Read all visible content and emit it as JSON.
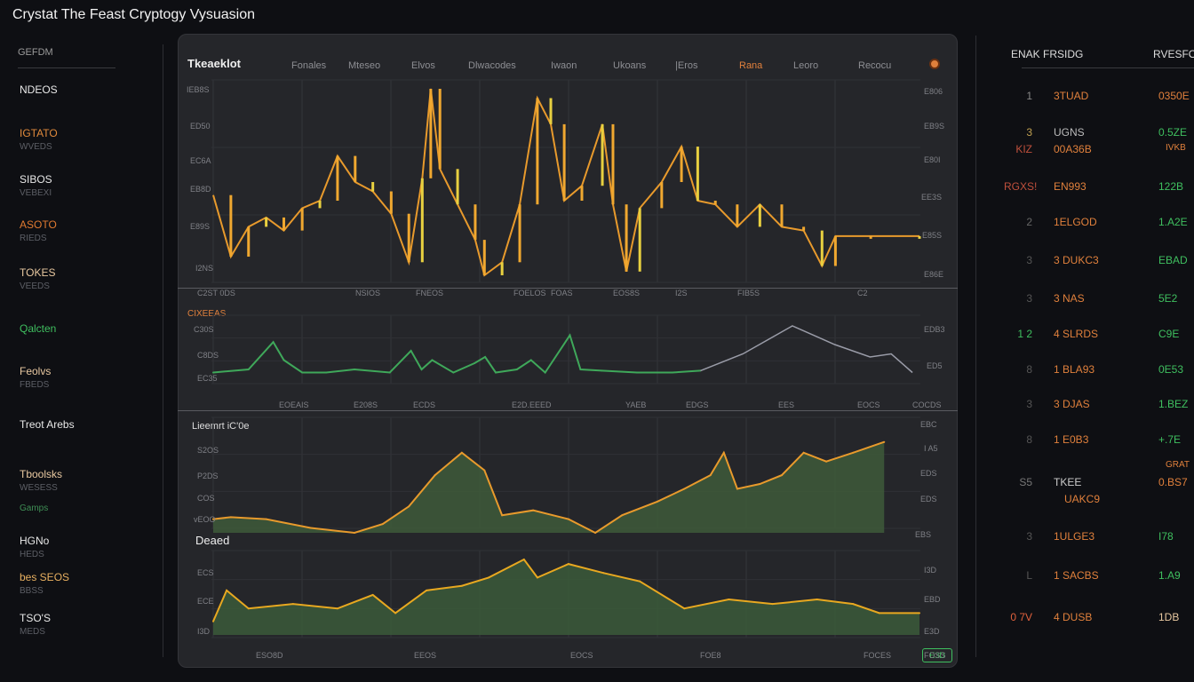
{
  "title": "Crystat The Feast Cryptogy Vysuasion",
  "sidebar": {
    "heading": "GEFDM",
    "items": [
      {
        "label": "NDEOS",
        "sub": "",
        "color": "#e8e8e8"
      },
      {
        "label": "IGTATO",
        "sub": "WVEDS",
        "color": "#e08a3c"
      },
      {
        "label": "SIBOS",
        "sub": "VEBEXI",
        "color": "#e8e8e8"
      },
      {
        "label": "ASOTO",
        "sub": "RIEDS",
        "color": "#e07a30"
      },
      {
        "label": "TOKES",
        "sub": "VEEDS",
        "color": "#e8c8a0"
      },
      {
        "label": "Qalcten",
        "sub": "",
        "color": "#3fbf5f"
      },
      {
        "label": "Feolvs",
        "sub": "FBEDS",
        "color": "#e8c8a0"
      },
      {
        "label": "Treot Arebs",
        "sub": "",
        "color": "#e8e8e8"
      },
      {
        "label": "Tboolsks",
        "sub": "WESESS",
        "color": "#e8c8a0",
        "extra": "Gamps"
      },
      {
        "label": "HGNo",
        "sub": "HEDS",
        "color": "#e8e8e8"
      },
      {
        "label": "bes SEOS",
        "sub": "BBSS",
        "color": "#e8b060"
      },
      {
        "label": "TSO'S",
        "sub": "MEDS",
        "color": "#e8e8e8"
      }
    ]
  },
  "main": {
    "panel_title": "Tkeaeklot",
    "tabs": [
      "Fonales",
      "Mteseo",
      "Elvos",
      "Dlwacodes",
      "Iwaon",
      "Ukoans",
      "|Eros",
      "Rana",
      "Leoro",
      "Recocu"
    ],
    "active_tab": "Rana"
  },
  "axes": {
    "p1_left": [
      "IEB8S",
      "ED50",
      "EC6A",
      "EB8D",
      "E89S",
      "I2NS"
    ],
    "p1_right": [
      "E806",
      "EB9S",
      "E80I",
      "EE3S",
      "E85S",
      "E86E"
    ],
    "p1_bottom": [
      "C2ST 0DS",
      "NSIOS",
      "FNEOS",
      "FOELOS",
      "FOAS",
      "EOS8S",
      "I2S",
      "FIB5S",
      "C2"
    ],
    "p2_title": "CIXEEAS",
    "p2_left": [
      "C30S",
      "C8DS",
      "EC35"
    ],
    "p2_right": [
      "EDB3",
      "ED5"
    ],
    "p2_bottom": [
      "EOEAIS",
      "E208S",
      "ECDS",
      "E2D.EEED",
      "YAEB",
      "EDGS",
      "EES",
      "EOCS",
      "COCDS"
    ],
    "p3_title": "Lieemrt iC'0e",
    "p3_left": [
      "S2OS",
      "P2DS",
      "COS",
      "vEOO"
    ],
    "p3_right": [
      "EBC",
      "I A5",
      "EDS",
      "EDS",
      "EBS"
    ],
    "p4_title": "Deaed",
    "p4_left": [
      "ECS",
      "ECE",
      "I3D"
    ],
    "p4_right": [
      "I3D",
      "EBD",
      "E3D"
    ],
    "p4_bottom": [
      "ESO8D",
      "EEOS",
      "EOCS",
      "FOE8",
      "FOCES",
      "FOSS"
    ]
  },
  "right_panel": {
    "col1": "ENAK FRSIDG",
    "col2": "RVESFO",
    "rows": [
      {
        "rank": "1",
        "name": "3TUAD",
        "value": "0350E",
        "rank_color": "#888",
        "name_color": "#e0803c",
        "value_color": "#e0803c"
      },
      {
        "rank": "3",
        "name": "UGNS",
        "value": "0.5ZE",
        "rank_color": "#c0a050",
        "name_color": "#bbb",
        "value_color": "#3fbf5f",
        "rank2": "KIZ",
        "name2": "00A36B",
        "value2": "IVKB"
      },
      {
        "rank": "RGXS!",
        "name": "EN993",
        "value": "122B",
        "rank_color": "#c0503c",
        "name_color": "#e0803c",
        "value_color": "#3fbf5f"
      },
      {
        "rank": "2",
        "name": "1ELGOD",
        "value": "1.A2E",
        "rank_color": "#666",
        "name_color": "#e0803c",
        "value_color": "#3fbf5f"
      },
      {
        "rank": "3",
        "name": "3 DUKC3",
        "value": "EBAD",
        "rank_color": "#555",
        "name_color": "#e0803c",
        "value_color": "#3fbf5f"
      },
      {
        "rank": "3",
        "name": "3 NAS",
        "value": "5E2",
        "rank_color": "#555",
        "name_color": "#e0803c",
        "value_color": "#3fbf5f"
      },
      {
        "rank": "1 2",
        "name": "4 SLRDS",
        "value": "C9E",
        "rank_color": "#3fbf5f",
        "name_color": "#e0803c",
        "value_color": "#3fbf5f"
      },
      {
        "rank": "8",
        "name": "1 BLA93",
        "value": "0E53",
        "rank_color": "#555",
        "name_color": "#e0803c",
        "value_color": "#3fbf5f"
      },
      {
        "rank": "3",
        "name": "3 DJAS",
        "value": "1.BEZ",
        "rank_color": "#555",
        "name_color": "#e0803c",
        "value_color": "#3fbf5f"
      },
      {
        "rank": "8",
        "name": "1 E0B3",
        "value": "+.7E",
        "rank_color": "#555",
        "name_color": "#e0803c",
        "value_color": "#3fbf5f"
      },
      {
        "rank": "S5",
        "name": "TKEE",
        "value": "0.BS7",
        "rank_color": "#777",
        "name_color": "#ccc",
        "value_color": "#e0803c",
        "name2": "UAKC9",
        "value2": "GRAT"
      },
      {
        "rank": "3",
        "name": "1ULGE3",
        "value": "I78",
        "rank_color": "#555",
        "name_color": "#e0803c",
        "value_color": "#3fbf5f"
      },
      {
        "rank": "L",
        "name": "1 SACBS",
        "value": "1.A9",
        "rank_color": "#555",
        "name_color": "#e0803c",
        "value_color": "#3fbf5f"
      },
      {
        "rank": "0 7V",
        "name": "4 DUSB",
        "value": "1DB",
        "rank_color": "#e0603c",
        "name_color": "#e0803c",
        "value_color": "#e8c8a0"
      }
    ]
  },
  "chart_data": [
    {
      "type": "line",
      "name": "price",
      "color": "#e89a2c",
      "x": [
        0,
        2.5,
        5,
        7.5,
        10,
        12.6,
        15.1,
        17.6,
        20.1,
        22.6,
        25.2,
        27.7,
        29.6,
        30.8,
        32.1,
        34.6,
        37.1,
        38.4,
        40.9,
        43.4,
        45.9,
        47.8,
        49.7,
        52.2,
        55.1,
        56.6,
        58.5,
        60.4,
        63.5,
        66.3,
        68.6,
        71.1,
        74.2,
        77.4,
        80.5,
        83.6,
        86.2,
        88.1,
        93.1,
        100
      ],
      "y": [
        43,
        10,
        26,
        31,
        24,
        36,
        40,
        64,
        50,
        45,
        33,
        7,
        52,
        100,
        57,
        38,
        19,
        0,
        7,
        38,
        95,
        81,
        40,
        48,
        81,
        38,
        2,
        36,
        50,
        69,
        40,
        38,
        26,
        38,
        26,
        24,
        5,
        21,
        21,
        21
      ],
      "ylim": [
        0,
        100
      ]
    },
    {
      "type": "line",
      "name": "volume",
      "color": "#3fa85a",
      "x": [
        0,
        5,
        8.5,
        10,
        12.6,
        16,
        20,
        25,
        28,
        29.5,
        31,
        34,
        37,
        38.5,
        40,
        43,
        45,
        47,
        50.5,
        52,
        55,
        60,
        65,
        69
      ],
      "y": [
        15,
        20,
        64,
        35,
        15,
        15,
        20,
        15,
        50,
        20,
        35,
        15,
        30,
        40,
        15,
        20,
        35,
        15,
        75,
        20,
        18,
        15,
        15,
        18
      ],
      "ylim": [
        0,
        100
      ],
      "series2": {
        "name": "trend",
        "color": "#9a9ca8",
        "x": [
          69,
          75,
          82,
          88,
          93,
          96,
          99
        ],
        "y": [
          18,
          45,
          90,
          60,
          40,
          45,
          15
        ]
      }
    },
    {
      "type": "area",
      "name": "liquidity",
      "color": "#e89a2c",
      "fill": "#3e5a3a",
      "x": [
        0,
        2.5,
        7.5,
        13.8,
        20,
        24,
        27.7,
        31.4,
        35.2,
        38.4,
        40.9,
        45.3,
        50.3,
        54.1,
        57.9,
        62.9,
        66.7,
        70.4,
        72.3,
        74.2,
        77.4,
        80.5,
        83.6,
        86.8,
        90.6,
        95
      ],
      "y": [
        14,
        16,
        14,
        5,
        0,
        9,
        27,
        59,
        82,
        64,
        18,
        23,
        14,
        0,
        18,
        32,
        45,
        59,
        82,
        45,
        50,
        59,
        82,
        73,
        82,
        93
      ],
      "ylim": [
        0,
        100
      ]
    },
    {
      "type": "area",
      "name": "depth",
      "color": "#e8a820",
      "fill": "#3b5a3a",
      "x": [
        0,
        1.9,
        5,
        11.3,
        17.6,
        22.6,
        25.8,
        30.2,
        35.2,
        39,
        44,
        45.9,
        50.3,
        55.3,
        60.4,
        66.7,
        73,
        79.2,
        85.5,
        90.6,
        94.3,
        100
      ],
      "y": [
        18,
        59,
        35,
        41,
        35,
        53,
        29,
        59,
        65,
        76,
        100,
        76,
        94,
        82,
        71,
        35,
        47,
        41,
        47,
        41,
        29,
        29
      ],
      "ylim": [
        0,
        100
      ]
    }
  ]
}
